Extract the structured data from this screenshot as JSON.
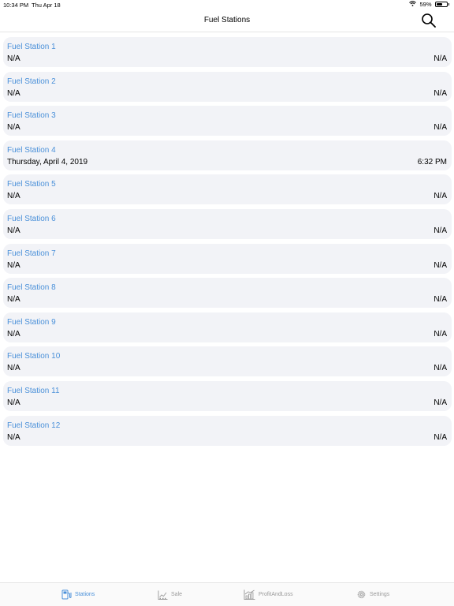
{
  "status_bar": {
    "time": "10:34 PM",
    "date": "Thu Apr 18",
    "battery_percent": "59%",
    "battery_level": 0.59
  },
  "nav": {
    "title": "Fuel Stations",
    "search_icon": "search-icon"
  },
  "stations": [
    {
      "name": "Fuel Station 1",
      "left": "N/A",
      "right": "N/A"
    },
    {
      "name": "Fuel Station 2",
      "left": "N/A",
      "right": "N/A"
    },
    {
      "name": "Fuel Station 3",
      "left": "N/A",
      "right": "N/A"
    },
    {
      "name": "Fuel Station 4",
      "left": "Thursday, April 4, 2019",
      "right": "6:32 PM"
    },
    {
      "name": "Fuel Station 5",
      "left": "N/A",
      "right": "N/A"
    },
    {
      "name": "Fuel Station 6",
      "left": "N/A",
      "right": "N/A"
    },
    {
      "name": "Fuel Station 7",
      "left": "N/A",
      "right": "N/A"
    },
    {
      "name": "Fuel Station 8",
      "left": "N/A",
      "right": "N/A"
    },
    {
      "name": "Fuel Station 9",
      "left": "N/A",
      "right": "N/A"
    },
    {
      "name": "Fuel Station 10",
      "left": "N/A",
      "right": "N/A"
    },
    {
      "name": "Fuel Station 11",
      "left": "N/A",
      "right": "N/A"
    },
    {
      "name": "Fuel Station 12",
      "left": "N/A",
      "right": "N/A"
    }
  ],
  "tabs": [
    {
      "label": "Stations",
      "icon": "fuel-pump-icon",
      "active": true
    },
    {
      "label": "Sale",
      "icon": "sale-chart-icon",
      "active": false
    },
    {
      "label": "ProfitAndLoss",
      "icon": "profit-loss-chart-icon",
      "active": false
    },
    {
      "label": "Settings",
      "icon": "gear-icon",
      "active": false
    }
  ],
  "colors": {
    "accent": "#4a90d9",
    "row_background": "#f2f3f7",
    "inactive_tab": "#9a9a9a"
  }
}
